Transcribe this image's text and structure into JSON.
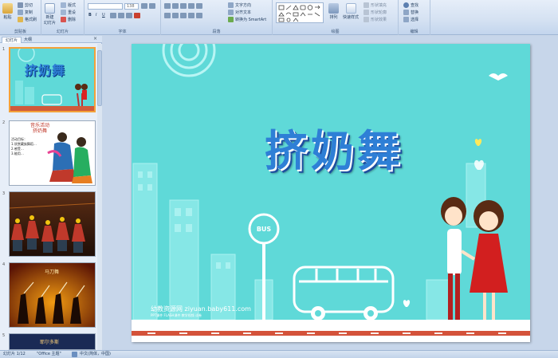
{
  "ribbon": {
    "clipboard": {
      "paste_label": "粘贴",
      "cut_label": "剪切",
      "copy_label": "复制",
      "format_painter_label": "格式刷",
      "group_label": "剪贴板"
    },
    "slides": {
      "new_slide_label": "新建\n幻灯片",
      "layout_label": "版式",
      "reset_label": "重设",
      "delete_label": "删除",
      "group_label": "幻灯片"
    },
    "font": {
      "size_value": "138",
      "group_label": "字体",
      "bold": "B",
      "italic": "I",
      "underline": "U"
    },
    "paragraph": {
      "text_direction_label": "文字方向",
      "align_text_label": "对齐文本",
      "smartart_label": "转换为 SmartArt",
      "group_label": "段落"
    },
    "drawing": {
      "arrange_label": "排列",
      "quick_styles_label": "快速样式",
      "shape_fill_label": "形状填充",
      "shape_outline_label": "形状轮廓",
      "shape_effects_label": "形状效果",
      "group_label": "绘图"
    },
    "editing": {
      "find_label": "查找",
      "replace_label": "替换",
      "select_label": "选择",
      "group_label": "编辑"
    }
  },
  "left_pane": {
    "tabs": [
      "幻灯片",
      "大纲"
    ],
    "close": "×",
    "thumbnails": [
      {
        "number": "1",
        "title": "挤奶舞"
      },
      {
        "number": "2",
        "title": "音乐活动\n挤奶舞",
        "body": "活动目标：\n1.欣赏藏族舞蹈…\n2.感受…\n3.能用…"
      },
      {
        "number": "3"
      },
      {
        "number": "4",
        "title": "马刀舞"
      },
      {
        "number": "5",
        "title": "耶尔多斯"
      }
    ]
  },
  "slide": {
    "title": "挤奶舞",
    "bus_sign": "BUS",
    "watermark": "幼教资源网 ziyuan.baby611.com",
    "watermark_sub": "PPT课件 FLASH课件 教学视频 试卷"
  },
  "statusbar": {
    "slide_counter": "幻灯片 1/12",
    "theme": "\"Office 主题\"",
    "language": "中文(简体，中国)"
  },
  "colors": {
    "slide_bg": "#5fd9d8",
    "title_blue": "#2e7fd6",
    "ribbon_bg": "#d4e1f2",
    "selected_thumb": "#f3a13a"
  }
}
